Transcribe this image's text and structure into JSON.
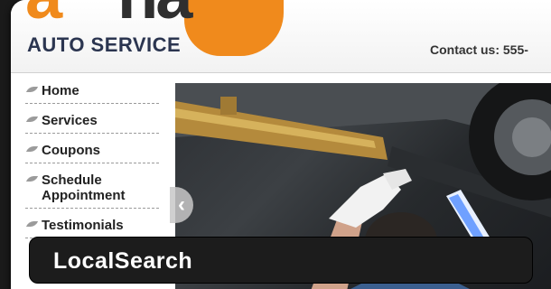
{
  "header": {
    "logo_letters_orange": "a",
    "logo_letters_dark": "na",
    "logo_text": "AUTO SERVICE",
    "contact": "Contact us: 555-"
  },
  "sidebar": {
    "items": [
      {
        "label": "Home"
      },
      {
        "label": "Services"
      },
      {
        "label": "Coupons"
      },
      {
        "label": "Schedule Appointment"
      },
      {
        "label": "Testimonials"
      }
    ]
  },
  "hero": {
    "prev_glyph": "‹"
  },
  "caption": {
    "label": "LocalSearch"
  },
  "colors": {
    "brand_orange": "#f08a1c",
    "brand_navy": "#2b3550",
    "caption_bg": "#1c1c1c"
  }
}
